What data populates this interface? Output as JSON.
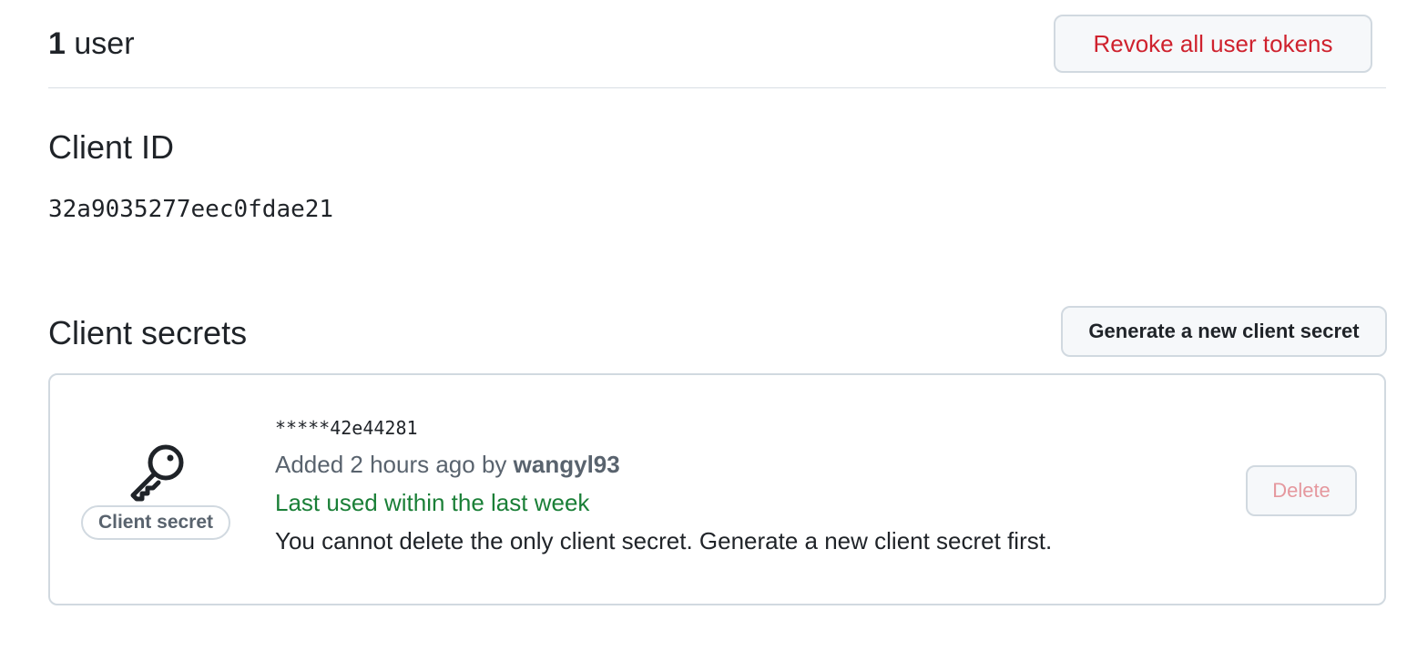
{
  "users": {
    "count": "1",
    "label": "user"
  },
  "revoke_button": {
    "label": "Revoke all user tokens"
  },
  "client_id": {
    "heading": "Client ID",
    "value": "32a9035277eec0fdae21"
  },
  "client_secrets": {
    "heading": "Client secrets",
    "generate_button": {
      "label": "Generate a new client secret"
    },
    "items": [
      {
        "icon": "key-icon",
        "badge": "Client secret",
        "masked_value": "*****42e44281",
        "added_prefix": "Added 2 hours ago by",
        "added_by": "wangyl93",
        "last_used": "Last used within the last week",
        "note": "You cannot delete the only client secret. Generate a new client secret first.",
        "delete_label": "Delete"
      }
    ]
  },
  "colors": {
    "danger": "#cf222e",
    "danger_disabled": "#e5989e",
    "success": "#1a7f37",
    "muted": "#59636e",
    "border": "#d1d9e0",
    "button_bg": "#f6f8fa"
  }
}
